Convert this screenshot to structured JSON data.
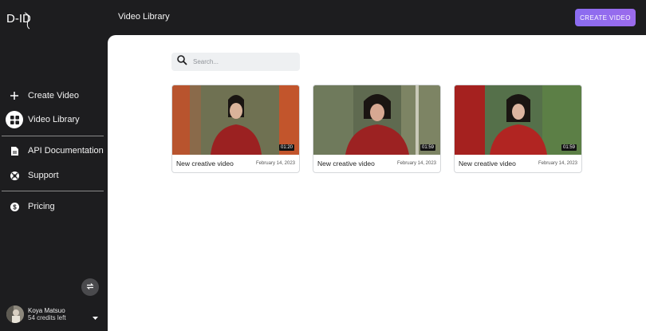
{
  "app": {
    "logo_text": "D-ID"
  },
  "header": {
    "title": "Video Library",
    "create_button": "CREATE VIDEO"
  },
  "sidebar": {
    "items": [
      {
        "label": "Create Video",
        "icon": "plus-icon",
        "active": false
      },
      {
        "label": "Video Library",
        "icon": "grid-icon",
        "active": true
      },
      {
        "label": "API Documentation",
        "icon": "document-icon",
        "active": false
      },
      {
        "label": "Support",
        "icon": "lifebuoy-icon",
        "active": false
      },
      {
        "label": "Pricing",
        "icon": "dollar-icon",
        "active": false
      }
    ]
  },
  "user": {
    "name": "Koya Matsuo",
    "credits": "54 credits left"
  },
  "search": {
    "placeholder": "Search..."
  },
  "videos": [
    {
      "title": "New creative video",
      "date": "February 14, 2023",
      "duration": "01:20"
    },
    {
      "title": "New creative video",
      "date": "February 14, 2023",
      "duration": "01:59"
    },
    {
      "title": "New creative video",
      "date": "February 14, 2023",
      "duration": "01:59"
    }
  ],
  "colors": {
    "sidebar_bg": "#1d1d1f",
    "accent": "#8b6cf0",
    "main_bg": "#ffffff"
  }
}
